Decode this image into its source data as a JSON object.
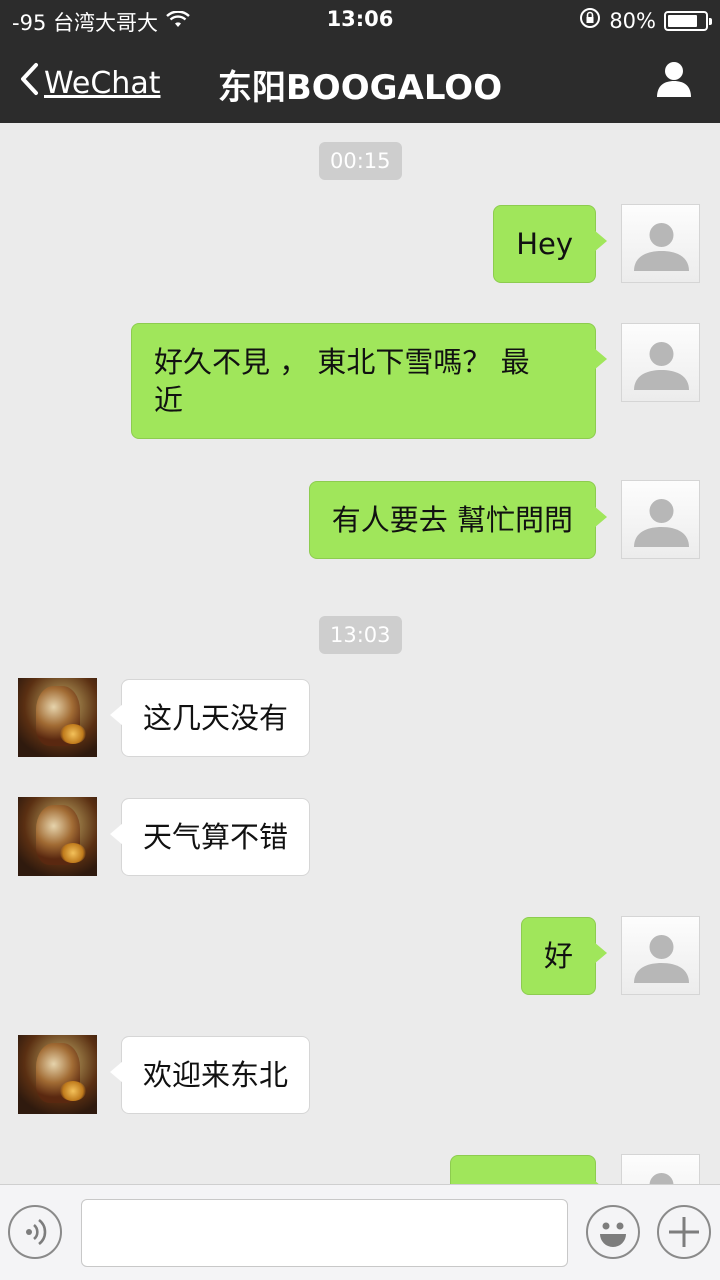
{
  "status_bar": {
    "carrier": "-95 台湾大哥大",
    "time": "13:06",
    "battery": "80%",
    "battery_level": 0.8
  },
  "nav": {
    "back_label": "WeChat",
    "title": "东阳BOOGALOO"
  },
  "messages": {
    "ts1": "00:15",
    "m1": "Hey",
    "m2_line1": "好久不見 ， 東北下雪嗎？ 最",
    "m2_line2": "近",
    "m3": "有人要去 幫忙問問",
    "ts2": "13:03",
    "m4": "这几天没有",
    "m5": "天气算不错",
    "m6": "好",
    "m7": "欢迎来东北"
  },
  "colors": {
    "nav_bg": "#2c2c2c",
    "chat_bg": "#ebebeb",
    "outgoing_bubble": "#a0e65b",
    "incoming_bubble": "#ffffff",
    "timestamp_bg": "#cecece"
  },
  "icons": {
    "back": "chevron-left-icon",
    "profile": "person-icon",
    "voice": "voice-icon",
    "emoji": "emoji-icon",
    "add": "plus-icon",
    "wifi": "wifi-icon",
    "lock": "rotation-lock-icon"
  }
}
